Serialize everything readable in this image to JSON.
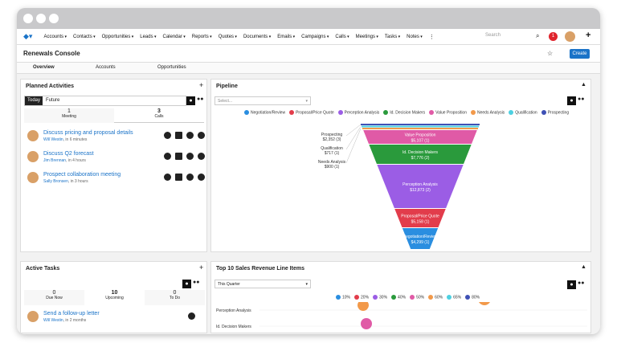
{
  "nav": {
    "items": [
      "Accounts",
      "Contacts",
      "Opportunities",
      "Leads",
      "Calendar",
      "Reports",
      "Quotes",
      "Documents",
      "Emails",
      "Campaigns",
      "Calls",
      "Meetings",
      "Tasks",
      "Notes"
    ],
    "search_placeholder": "Search",
    "notif_count": "1"
  },
  "header": {
    "title": "Renewals Console",
    "create_label": "Create"
  },
  "tabs": [
    "Overview",
    "Accounts",
    "Opportunities"
  ],
  "planned": {
    "title": "Planned Activities",
    "filters": [
      "Today",
      "Future"
    ],
    "counts": [
      {
        "num": "1",
        "label": "Meeting"
      },
      {
        "num": "3",
        "label": "Calls"
      }
    ],
    "rows": [
      {
        "title": "Discuss pricing and proposal details",
        "user": "Will Westin",
        "when": ", in 6 minutes"
      },
      {
        "title": "Discuss Q2 forecast",
        "user": "Jim Brennan",
        "when": ", in 4 hours"
      },
      {
        "title": "Prospect collaboration meeting",
        "user": "Sally Bronsen",
        "when": ", in 3 hours"
      }
    ]
  },
  "tasks": {
    "title": "Active Tasks",
    "counts": [
      {
        "num": "0",
        "label": "Due Now"
      },
      {
        "num": "10",
        "label": "Upcoming"
      },
      {
        "num": "0",
        "label": "To Do"
      }
    ],
    "rows": [
      {
        "title": "Send a follow-up letter",
        "user": "Will Westin",
        "when": ", in 2 months"
      }
    ]
  },
  "pipeline": {
    "title": "Pipeline",
    "select_placeholder": "Select...",
    "legend": [
      {
        "name": "Negotiation/Review",
        "color": "#2a8ee0"
      },
      {
        "name": "Proposal/Price Quote",
        "color": "#e23c4b"
      },
      {
        "name": "Perception Analysis",
        "color": "#9b5de5"
      },
      {
        "name": "Id. Decision Makers",
        "color": "#2a9a3c"
      },
      {
        "name": "Value Proposition",
        "color": "#e05aa6"
      },
      {
        "name": "Needs Analysis",
        "color": "#f2994a"
      },
      {
        "name": "Qualification",
        "color": "#4dd0e1"
      },
      {
        "name": "Prospecting",
        "color": "#3f51b5"
      }
    ],
    "side_labels": [
      {
        "name": "Prospecting",
        "value": "$2,352 (3)"
      },
      {
        "name": "Qualification",
        "value": "$717 (1)"
      },
      {
        "name": "Needs Analysis",
        "value": "$900 (1)"
      }
    ],
    "segments": [
      {
        "name": "Value Proposition",
        "value": "$5,107 (1)",
        "color": "#e05aa6"
      },
      {
        "name": "Id. Decision Makers",
        "value": "$7,776 (2)",
        "color": "#2a9a3c"
      },
      {
        "name": "Perception Analysis",
        "value": "$12,873 (2)",
        "color": "#9b5de5"
      },
      {
        "name": "Proposal/Price Quote",
        "value": "$5,158 (1)",
        "color": "#e23c4b"
      },
      {
        "name": "Negotiation/Review",
        "value": "$4,299 (1)",
        "color": "#2a8ee0"
      }
    ]
  },
  "revenue": {
    "title": "Top 10 Sales Revenue Line Items",
    "period": "This Quarter",
    "legend": [
      {
        "name": "10%",
        "color": "#2a8ee0"
      },
      {
        "name": "20%",
        "color": "#e23c4b"
      },
      {
        "name": "30%",
        "color": "#9b5de5"
      },
      {
        "name": "40%",
        "color": "#2a9a3c"
      },
      {
        "name": "50%",
        "color": "#e05aa6"
      },
      {
        "name": "60%",
        "color": "#f2994a"
      },
      {
        "name": "65%",
        "color": "#4dd0e1"
      },
      {
        "name": "80%",
        "color": "#3f51b5"
      }
    ],
    "rows": [
      "Perception Analysis",
      "Id. Decision Makers"
    ]
  }
}
